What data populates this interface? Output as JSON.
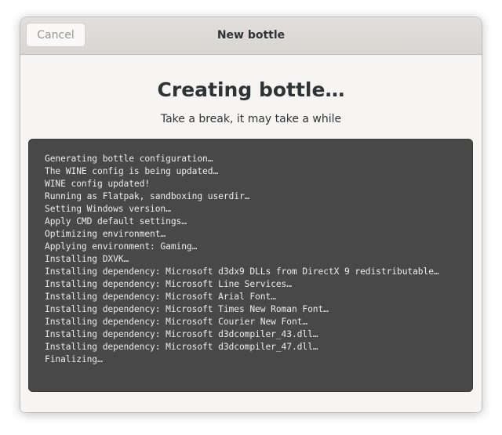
{
  "window": {
    "title": "New bottle",
    "cancel_label": "Cancel"
  },
  "content": {
    "heading": "Creating bottle…",
    "subheading": "Take a break, it may take a while"
  },
  "log": {
    "lines": [
      "Generating bottle configuration…",
      "The WINE config is being updated…",
      "WINE config updated!",
      "Running as Flatpak, sandboxing userdir…",
      "Setting Windows version…",
      "Apply CMD default settings…",
      "Optimizing environment…",
      "Applying environment: Gaming…",
      "Installing DXVK…",
      "Installing dependency: Microsoft d3dx9 DLLs from DirectX 9 redistributable…",
      "Installing dependency: Microsoft Line Services…",
      "Installing dependency: Microsoft Arial Font…",
      "Installing dependency: Microsoft Times New Roman Font…",
      "Installing dependency: Microsoft Courier New Font…",
      "Installing dependency: Microsoft d3dcompiler_43.dll…",
      "Installing dependency: Microsoft d3dcompiler_47.dll…",
      "Finalizing…"
    ]
  }
}
